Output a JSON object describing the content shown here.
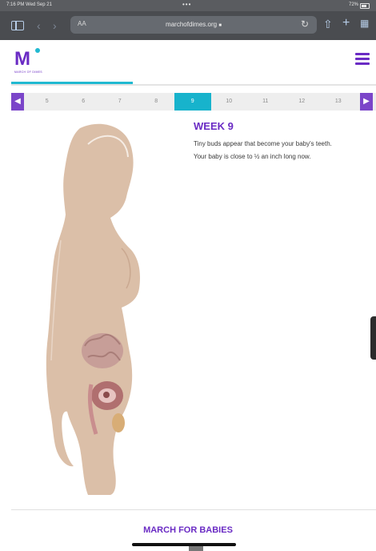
{
  "status_bar": {
    "time": "7:16 PM  Wed Sep 21",
    "dots": "•••",
    "battery": "72%"
  },
  "browser": {
    "aa_label": "AA",
    "url": "marchofdimes.org",
    "lock": "🔒",
    "icons": [
      "sidebar-icon",
      "back-icon",
      "forward-icon",
      "reload-icon",
      "share-icon",
      "new-tab-icon",
      "tabs-icon"
    ]
  },
  "site": {
    "logo_text": "M",
    "logo_sub": "MARCH OF DIMES",
    "brand_color": "#6a2bc4",
    "accent_color": "#21b9d1"
  },
  "week_selector": {
    "weeks": [
      "5",
      "6",
      "7",
      "8",
      "9",
      "10",
      "11",
      "12",
      "13"
    ],
    "selected": "9",
    "progress_fraction": 0.33
  },
  "content": {
    "title": "WEEK 9",
    "lines": [
      "Tiny buds appear that become your baby's teeth.",
      "Your baby is close to ½ an inch long now."
    ]
  },
  "footer": {
    "title": "MARCH FOR BABIES"
  }
}
